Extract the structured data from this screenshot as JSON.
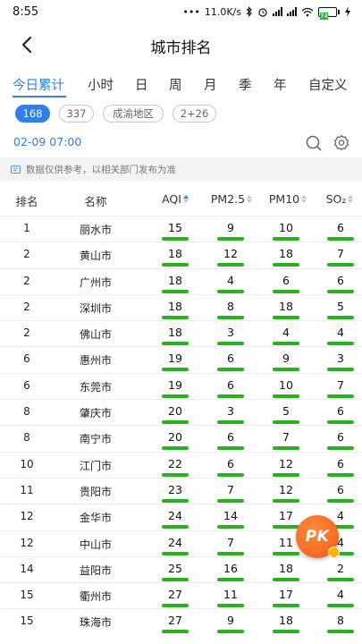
{
  "status": {
    "time": "8:55",
    "net_speed": "11.0K/s",
    "battery": "74"
  },
  "header": {
    "title": "城市排名"
  },
  "tabs": [
    {
      "label": "今日累计",
      "active": true
    },
    {
      "label": "小时"
    },
    {
      "label": "日"
    },
    {
      "label": "周"
    },
    {
      "label": "月"
    },
    {
      "label": "季"
    },
    {
      "label": "年"
    },
    {
      "label": "自定义"
    }
  ],
  "chips": [
    {
      "label": "168",
      "active": true
    },
    {
      "label": "337"
    },
    {
      "label": "成渝地区"
    },
    {
      "label": "2+26"
    }
  ],
  "datetime": "02-09 07:00",
  "notice": "数据仅供参考，以相关部门发布为准",
  "columns": {
    "rank": "排名",
    "name": "名称",
    "aqi": "AQI",
    "pm25": "PM2.5",
    "pm10": "PM10",
    "so2": "SO₂"
  },
  "rows": [
    {
      "rank": "1",
      "name": "丽水市",
      "aqi": "15",
      "pm25": "9",
      "pm10": "10",
      "so2": "6"
    },
    {
      "rank": "2",
      "name": "黄山市",
      "aqi": "18",
      "pm25": "12",
      "pm10": "18",
      "so2": "7"
    },
    {
      "rank": "2",
      "name": "广州市",
      "aqi": "18",
      "pm25": "4",
      "pm10": "6",
      "so2": "6"
    },
    {
      "rank": "2",
      "name": "深圳市",
      "aqi": "18",
      "pm25": "8",
      "pm10": "18",
      "so2": "5"
    },
    {
      "rank": "2",
      "name": "佛山市",
      "aqi": "18",
      "pm25": "3",
      "pm10": "4",
      "so2": "4"
    },
    {
      "rank": "6",
      "name": "惠州市",
      "aqi": "19",
      "pm25": "6",
      "pm10": "9",
      "so2": "3"
    },
    {
      "rank": "6",
      "name": "东莞市",
      "aqi": "19",
      "pm25": "6",
      "pm10": "10",
      "so2": "7"
    },
    {
      "rank": "8",
      "name": "肇庆市",
      "aqi": "20",
      "pm25": "3",
      "pm10": "5",
      "so2": "6"
    },
    {
      "rank": "8",
      "name": "南宁市",
      "aqi": "20",
      "pm25": "6",
      "pm10": "7",
      "so2": "6"
    },
    {
      "rank": "10",
      "name": "江门市",
      "aqi": "22",
      "pm25": "6",
      "pm10": "12",
      "so2": "6"
    },
    {
      "rank": "11",
      "name": "贵阳市",
      "aqi": "23",
      "pm25": "7",
      "pm10": "12",
      "so2": "6"
    },
    {
      "rank": "12",
      "name": "金华市",
      "aqi": "24",
      "pm25": "14",
      "pm10": "17",
      "so2": "4"
    },
    {
      "rank": "12",
      "name": "中山市",
      "aqi": "24",
      "pm25": "7",
      "pm10": "11",
      "so2": "4"
    },
    {
      "rank": "14",
      "name": "益阳市",
      "aqi": "25",
      "pm25": "16",
      "pm10": "18",
      "so2": "2"
    },
    {
      "rank": "15",
      "name": "衢州市",
      "aqi": "27",
      "pm25": "11",
      "pm10": "17",
      "so2": "4"
    },
    {
      "rank": "15",
      "name": "珠海市",
      "aqi": "27",
      "pm25": "9",
      "pm10": "18",
      "so2": "8"
    }
  ],
  "pk_button": {
    "label": "PK"
  },
  "colors": {
    "accent": "#2f7ff0",
    "good_level": "#27b21e",
    "pk_orange": "#f15a16"
  }
}
